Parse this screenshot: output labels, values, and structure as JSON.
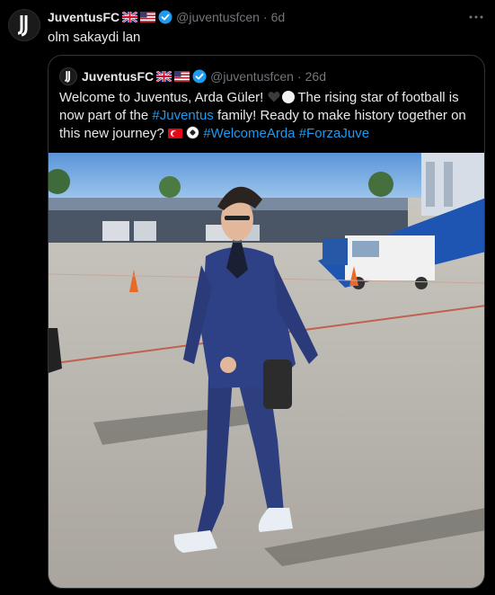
{
  "tweet": {
    "author_name": "JuventusFC",
    "author_handle": "@juventusfcen",
    "separator": "·",
    "time": "6d",
    "text": "olm sakaydi lan",
    "more_icon": "more-horizontal-icon"
  },
  "quote": {
    "author_name": "JuventusFC",
    "author_handle": "@juventusfcen",
    "separator": "·",
    "time": "26d",
    "text_1": "Welcome to Juventus, Arda Güler! ",
    "text_2": " The rising star of football is now part of the ",
    "hashtag_juventus": "#Juventus",
    "text_3": " family! Ready to make history together on this new journey? ",
    "hashtag_welcome": "#WelcomeArda",
    "hashtag_forza": "#ForzaJuve",
    "photo_icon": "player-walking-photo"
  },
  "colors": {
    "background": "#000000",
    "text": "#e7e9ea",
    "muted": "#71767b",
    "link": "#1d9bf0",
    "border": "#2f3336",
    "verified": "#1d9bf0"
  }
}
